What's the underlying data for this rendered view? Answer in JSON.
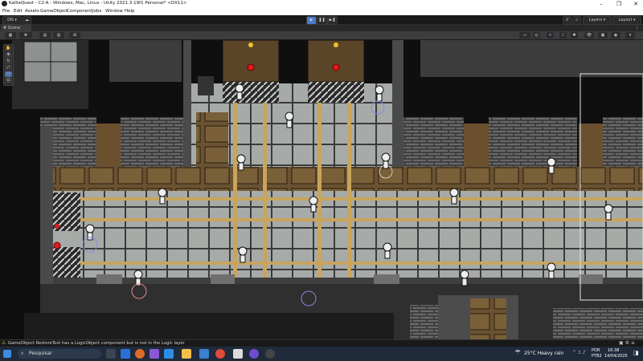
{
  "window": {
    "title": "KallieQuest - C2-A - Windows, Mac, Linux - Unity 2021.3.19f1 Personal* <DX11>",
    "controls": [
      "–",
      "❐",
      "✕"
    ]
  },
  "menu": [
    "File",
    "Edit",
    "Assets",
    "GameObject",
    "Component",
    "Jobs",
    "Window",
    "Help"
  ],
  "toolbar": {
    "account": "DN",
    "layers_label": "Layers",
    "layout_label": "Layout"
  },
  "scene_tab": {
    "label": "Scene"
  },
  "status": {
    "warning_message": "GameObject RestoreTest has a LogicObject component but is not in the Logic layer"
  },
  "taskbar": {
    "search_placeholder": "Pesquisar",
    "weather": "25°C  Heavy rain",
    "lang_top": "POR",
    "lang_bottom": "PTB2",
    "time": "16:38",
    "date": "14/04/2025"
  },
  "colors": {
    "floor_tile": "#a7aba8",
    "wall": "#4f4f4f",
    "wood": "#6d5230",
    "gizmo_red": "#e01a1a"
  }
}
